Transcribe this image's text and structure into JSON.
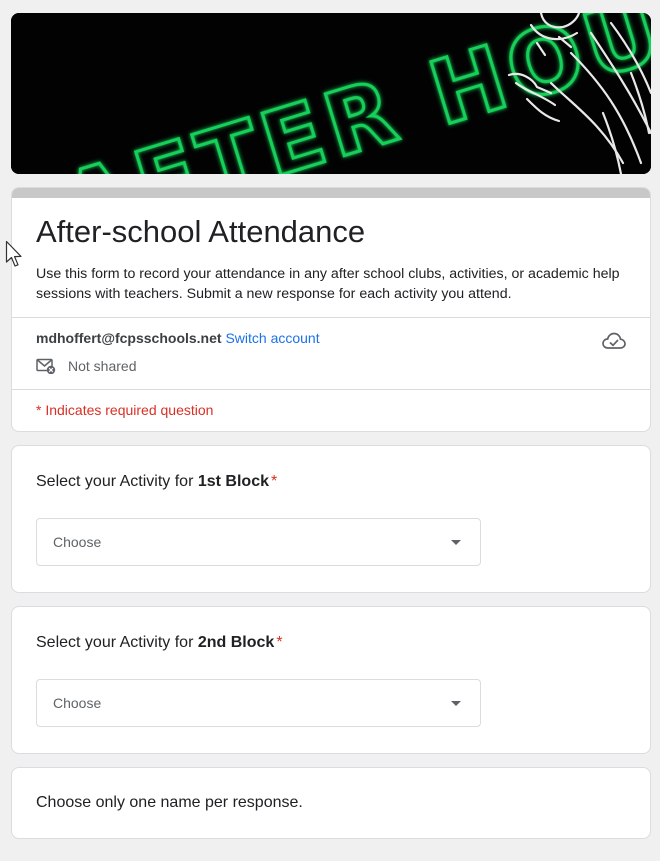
{
  "banner": {
    "text": "AFTER HOURS"
  },
  "header": {
    "title": "After-school Attendance",
    "description": "Use this form to record your attendance in any after school clubs, activities, or academic help sessions with teachers.  Submit a new response for each activity you attend."
  },
  "account": {
    "email": "mdhoffert@fcpsschools.net",
    "switch_label": "Switch account",
    "shared_status": "Not shared",
    "icons": [
      "mail-crossed-icon",
      "cloud-check-icon"
    ]
  },
  "required_note": "* Indicates required question",
  "questions": [
    {
      "prefix": "Select your Activity for ",
      "bold": "1st Block",
      "star": "*",
      "dropdown_placeholder": "Choose"
    },
    {
      "prefix": "Select your Activity for ",
      "bold": "2nd Block",
      "star": "*",
      "dropdown_placeholder": "Choose"
    }
  ],
  "note": "Choose only one name per response.",
  "colors": {
    "accent_link": "#1a73e8",
    "required_red": "#d93025",
    "banner_neon": "#19d05a",
    "background": "#f0f0f0"
  }
}
